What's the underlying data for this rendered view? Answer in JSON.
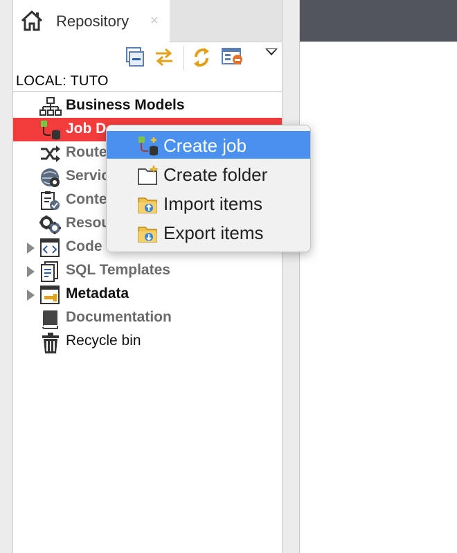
{
  "repository": {
    "tab_title": "Repository",
    "tab_close": "×",
    "minimize": "−",
    "maximize": "+",
    "project_label": "LOCAL: TUTO"
  },
  "tree": {
    "items": [
      {
        "label": "Business Models",
        "icon": "hierarchy-icon"
      },
      {
        "label": "Job Designs",
        "icon": "job-icon",
        "selected": true,
        "visible_label": "Job D"
      },
      {
        "label": "Routes",
        "visible_label": "Route",
        "icon": "routes-icon"
      },
      {
        "label": "Services",
        "visible_label": "Servic",
        "icon": "services-icon"
      },
      {
        "label": "Contexts",
        "visible_label": "Conte",
        "icon": "contexts-icon"
      },
      {
        "label": "Resources",
        "visible_label": "Resou",
        "icon": "resources-icon"
      },
      {
        "label": "Code",
        "visible_label": "Code",
        "icon": "code-icon",
        "expandable": true
      },
      {
        "label": "SQL Templates",
        "icon": "sql-templates-icon",
        "expandable": true
      },
      {
        "label": "Metadata",
        "icon": "metadata-icon",
        "expandable": true
      },
      {
        "label": "Documentation",
        "icon": "documentation-icon"
      },
      {
        "label": "Recycle bin",
        "icon": "recycle-bin-icon"
      }
    ]
  },
  "context_menu": {
    "items": [
      {
        "label": "Create job",
        "icon": "create-job-icon",
        "highlighted": true
      },
      {
        "label": "Create folder",
        "icon": "create-folder-icon"
      },
      {
        "label": "Import items",
        "icon": "import-items-icon"
      },
      {
        "label": "Export items",
        "icon": "export-items-icon"
      }
    ]
  },
  "colors": {
    "selection_red": "#f23c3c",
    "menu_highlight": "#4a90ee",
    "editor_bar": "#52555d"
  }
}
